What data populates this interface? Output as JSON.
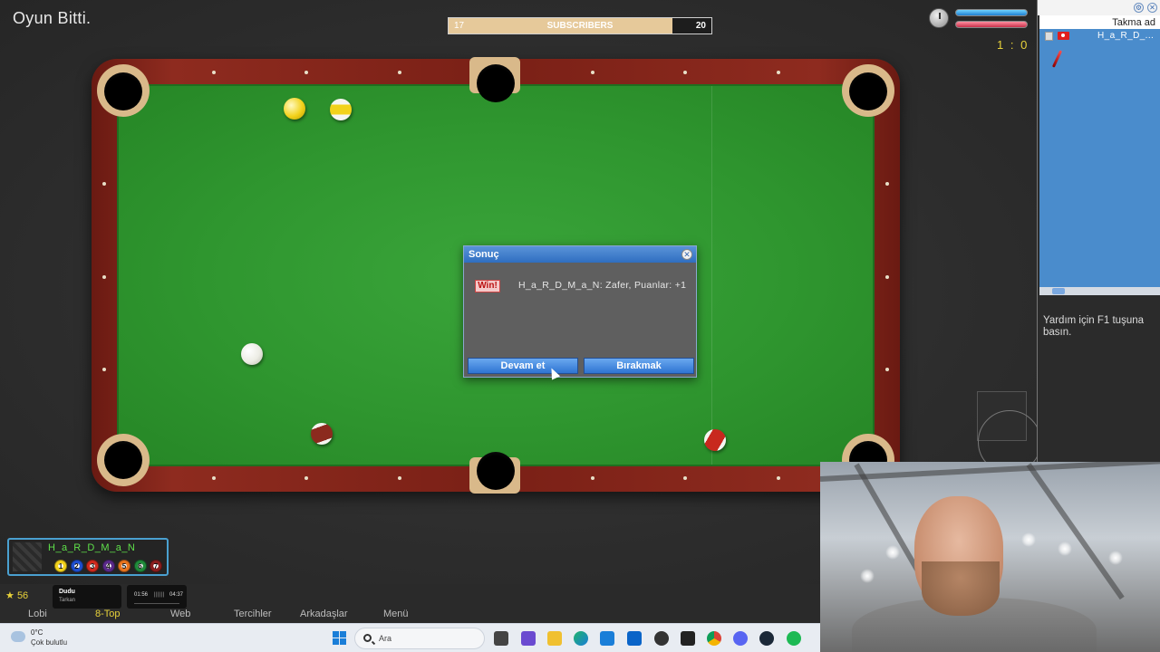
{
  "game": {
    "status_text": "Oyun Bitti.",
    "score": "1 : 0"
  },
  "subscribers": {
    "left_value": "17",
    "label": "SUBSCRIBERS",
    "right_value": "20",
    "progress": 0.85
  },
  "table": {
    "balls": [
      {
        "name": "yellow-ball",
        "color": "#f2d21b",
        "style": "solid"
      },
      {
        "name": "striped-ball-top",
        "color": "#f2d21b",
        "style": "stripe"
      },
      {
        "name": "cue-ball",
        "color": "#f7f7f2",
        "style": "solid"
      },
      {
        "name": "maroon-striped-ball",
        "color": "#8b2a1e",
        "style": "stripe"
      },
      {
        "name": "red-striped-ball",
        "color": "#c8281e",
        "style": "stripe"
      }
    ]
  },
  "dialog": {
    "title": "Sonuç",
    "badge": "Win!",
    "message": "H_a_R_D_M_a_N: Zafer,  Puanlar: +1",
    "continue_label": "Devam et",
    "leave_label": "Bırakmak"
  },
  "player": {
    "name": "H_a_R_D_M_a_N",
    "balls": [
      {
        "label": "1",
        "color": "#f2d21b"
      },
      {
        "label": "2",
        "color": "#1f4fd0"
      },
      {
        "label": "3",
        "color": "#d02a1e"
      },
      {
        "label": "4",
        "color": "#5a2a8a"
      },
      {
        "label": "5",
        "color": "#e8741e"
      },
      {
        "label": "6",
        "color": "#1f8a3a"
      },
      {
        "label": "7",
        "color": "#8b1e1e"
      }
    ]
  },
  "bottom_bar": {
    "stars": "56",
    "media_title": "Dudu",
    "media_artist": "Tarkan",
    "media_time_start": "01:56",
    "media_time_bars": "||||||",
    "media_time_end": "04:37",
    "menu": [
      "Lobi",
      "8-Top",
      "Web",
      "Tercihler",
      "Arkadaşlar",
      "Menü"
    ],
    "active_menu": "8-Top",
    "active_color": "#e8d23a"
  },
  "side_panel": {
    "column_header": "Takma ad",
    "user": "H_a_R_D_...",
    "help_text": "Yardım için F1 tuşuna basın."
  },
  "taskbar": {
    "temperature": "0°C",
    "weather": "Çok bulutlu",
    "search_placeholder": "Ara",
    "apps": [
      "files-icon",
      "teams-icon",
      "explorer-icon",
      "edge-icon",
      "store-icon",
      "outlook-icon",
      "game-icon",
      "terminal-icon",
      "chrome-icon",
      "discord-icon",
      "steam-icon",
      "spotify-icon"
    ]
  }
}
